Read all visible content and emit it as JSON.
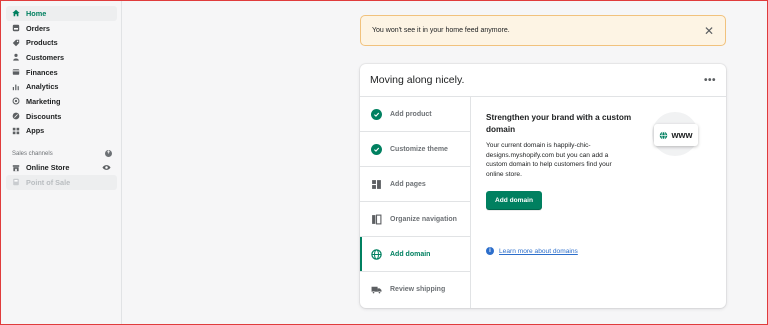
{
  "sidebar": {
    "items": [
      {
        "label": "Home",
        "icon": "home-icon"
      },
      {
        "label": "Orders",
        "icon": "orders-icon"
      },
      {
        "label": "Products",
        "icon": "products-icon"
      },
      {
        "label": "Customers",
        "icon": "customers-icon"
      },
      {
        "label": "Finances",
        "icon": "finances-icon"
      },
      {
        "label": "Analytics",
        "icon": "analytics-icon"
      },
      {
        "label": "Marketing",
        "icon": "marketing-icon"
      },
      {
        "label": "Discounts",
        "icon": "discounts-icon"
      },
      {
        "label": "Apps",
        "icon": "apps-icon"
      }
    ],
    "sales_channels_label": "Sales channels",
    "channels": [
      {
        "label": "Online Store"
      },
      {
        "label": "Point of Sale"
      }
    ]
  },
  "banner": {
    "text": "You won't see it in your home feed anymore.",
    "close": "✕"
  },
  "card": {
    "title": "Moving along nicely.",
    "more": "•••",
    "steps": [
      {
        "label": "Add product",
        "status": "done"
      },
      {
        "label": "Customize theme",
        "status": "done"
      },
      {
        "label": "Add pages",
        "status": "todo"
      },
      {
        "label": "Organize navigation",
        "status": "todo"
      },
      {
        "label": "Add domain",
        "status": "active"
      },
      {
        "label": "Review shipping",
        "status": "todo"
      }
    ],
    "detail": {
      "heading": "Strengthen your brand with a custom domain",
      "body": "Your current domain is happily-chic-designs.myshopify.com but you can add a custom domain to help customers find your online store.",
      "button": "Add domain",
      "learn_more": "Learn more about domains",
      "illustration_text": "www"
    }
  },
  "colors": {
    "accent": "#008060",
    "link": "#2c6ecb",
    "banner_bg": "#fdf4e4",
    "banner_border": "#f1c27d"
  }
}
